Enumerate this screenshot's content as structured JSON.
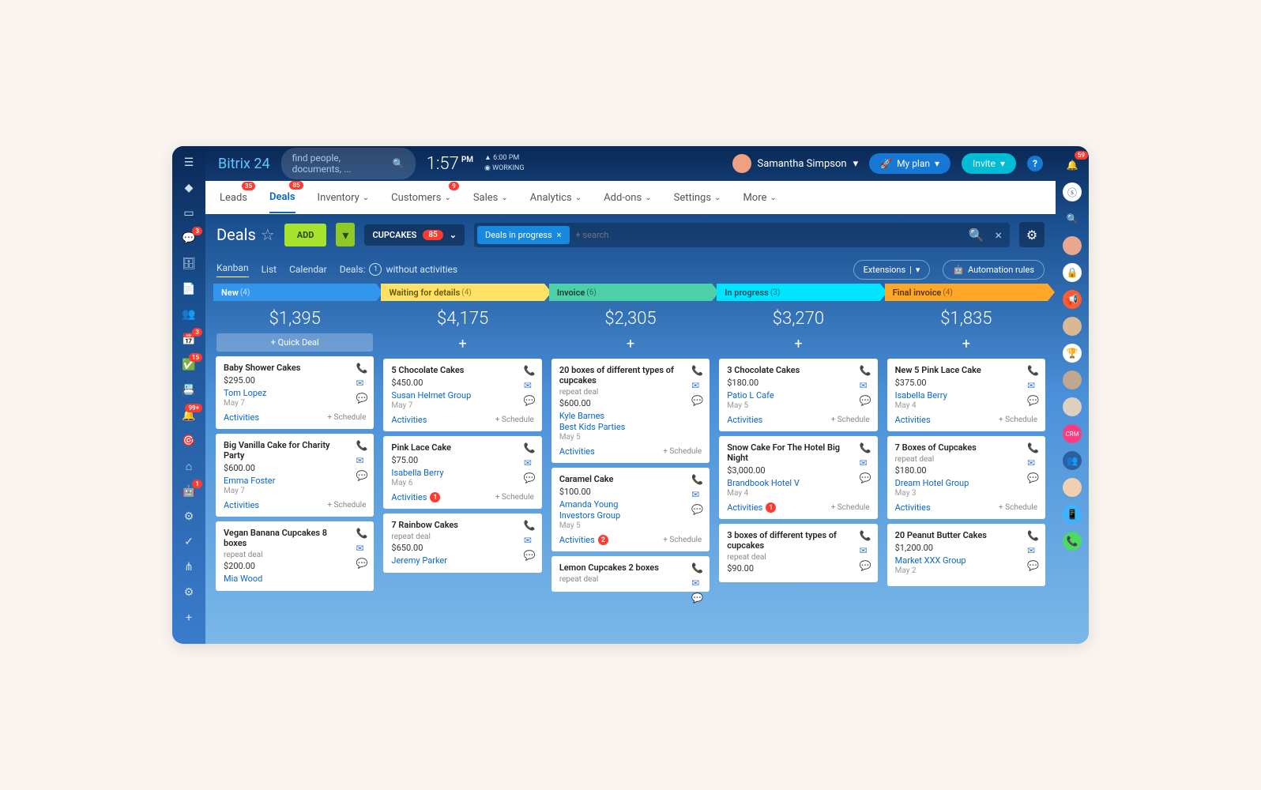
{
  "brand": {
    "name": "Bitrix",
    "suffix": "24"
  },
  "search_placeholder": "find people, documents, ...",
  "clock": {
    "time": "1:57",
    "pm": "PM",
    "sub1": "▲ 6:00 PM",
    "sub2": "◉ WORKING"
  },
  "user_name": "Samantha Simpson",
  "buttons": {
    "my_plan": "My plan",
    "invite": "Invite",
    "add": "ADD",
    "quick_deal": "+  Quick Deal",
    "extensions": "Extensions",
    "automation": "Automation rules"
  },
  "nav": [
    {
      "label": "Leads",
      "badge": "35"
    },
    {
      "label": "Deals",
      "badge": "85",
      "active": true
    },
    {
      "label": "Inventory"
    },
    {
      "label": "Customers",
      "badge": "9"
    },
    {
      "label": "Sales"
    },
    {
      "label": "Analytics"
    },
    {
      "label": "Add-ons"
    },
    {
      "label": "Settings"
    },
    {
      "label": "More"
    }
  ],
  "page_title": "Deals",
  "category": {
    "name": "CUPCAKES",
    "count": "85"
  },
  "filter_chip": "Deals in progress",
  "filter_placeholder": "+ search",
  "subtabs": {
    "kanban": "Kanban",
    "list": "List",
    "calendar": "Calendar",
    "deals_label": "Deals:",
    "deals_num": "1",
    "deals_suffix": "without activities"
  },
  "left_badges": {
    "msg": "3",
    "cal": "3",
    "check": "15",
    "bell": "99+",
    "notif": "59",
    "robot": "1"
  },
  "columns": [
    {
      "name": "New",
      "count": "(4)",
      "total": "$1,395",
      "cls": "c1",
      "quick": true,
      "cards": [
        {
          "title": "Baby Shower Cakes",
          "price": "$295.00",
          "contacts": [
            "Tom Lopez"
          ],
          "date": "May 7",
          "act": "Activities",
          "sch": "+ Schedule"
        },
        {
          "title": "Big Vanilla Cake for Charity Party",
          "price": "$600.00",
          "contacts": [
            "Emma Foster"
          ],
          "date": "May 7",
          "act": "Activities",
          "sch": "+ Schedule"
        },
        {
          "title": "Vegan Banana Cupcakes 8 boxes",
          "sub": "repeat deal",
          "price": "$200.00",
          "contacts": [
            "Mia Wood"
          ]
        }
      ]
    },
    {
      "name": "Waiting for details",
      "count": "(4)",
      "total": "$4,175",
      "cls": "c2",
      "cards": [
        {
          "title": "5 Chocolate Cakes",
          "price": "$450.00",
          "contacts": [
            "Susan Helmet Group"
          ],
          "date": "May 7",
          "act": "Activities",
          "sch": "+ Schedule"
        },
        {
          "title": "Pink Lace Cake",
          "price": "$75.00",
          "contacts": [
            "Isabella Berry"
          ],
          "date": "May 6",
          "act": "Activities",
          "act_n": "1",
          "sch": "+ Schedule"
        },
        {
          "title": "7 Rainbow Cakes",
          "sub": "repeat deal",
          "price": "$650.00",
          "contacts": [
            "Jeremy Parker"
          ]
        }
      ]
    },
    {
      "name": "Invoice",
      "count": "(6)",
      "total": "$2,305",
      "cls": "c3",
      "cards": [
        {
          "title": "20 boxes of different types of cupcakes",
          "sub": "repeat deal",
          "price": "$600.00",
          "contacts": [
            "Kyle Barnes",
            "Best Kids Parties"
          ],
          "date": "May 5",
          "act": "Activities",
          "sch": "+ Schedule"
        },
        {
          "title": "Caramel Cake",
          "price": "$100.00",
          "contacts": [
            "Amanda Young",
            "Investors Group"
          ],
          "date": "May 5",
          "act": "Activities",
          "act_n": "2",
          "sch": "+ Schedule"
        },
        {
          "title": "Lemon Cupcakes 2 boxes",
          "sub": "repeat deal"
        }
      ]
    },
    {
      "name": "In progress",
      "count": "(3)",
      "total": "$3,270",
      "cls": "c4",
      "cards": [
        {
          "title": "3 Chocolate Cakes",
          "price": "$180.00",
          "contacts": [
            "Patio L Cafe"
          ],
          "date": "May 5",
          "act": "Activities",
          "sch": "+ Schedule"
        },
        {
          "title": "Snow Cake For The Hotel Big Night",
          "price": "$3,000.00",
          "contacts": [
            "Brandbook Hotel V"
          ],
          "date": "May 4",
          "act": "Activities",
          "act_n": "1",
          "sch": "+ Schedule"
        },
        {
          "title": "3 boxes of different types of cupcakes",
          "sub": "repeat deal",
          "price": "$90.00"
        }
      ]
    },
    {
      "name": "Final invoice",
      "count": "(4)",
      "total": "$1,835",
      "cls": "c5",
      "cards": [
        {
          "title": "New 5 Pink Lace Cake",
          "price": "$375.00",
          "contacts": [
            "Isabella Berry"
          ],
          "date": "May 4",
          "act": "Activities",
          "sch": "+ Schedule"
        },
        {
          "title": "7 Boxes of Cupcakes",
          "sub": "repeat deal",
          "price": "$180.00",
          "contacts": [
            "Dream Hotel Group"
          ],
          "date": "May 3",
          "act": "Activities",
          "sch": "+ Schedule"
        },
        {
          "title": "20 Peanut Butter Cakes",
          "price": "$1,200.00",
          "contacts": [
            "Market XXX Group"
          ],
          "date": "May 2"
        }
      ]
    }
  ]
}
